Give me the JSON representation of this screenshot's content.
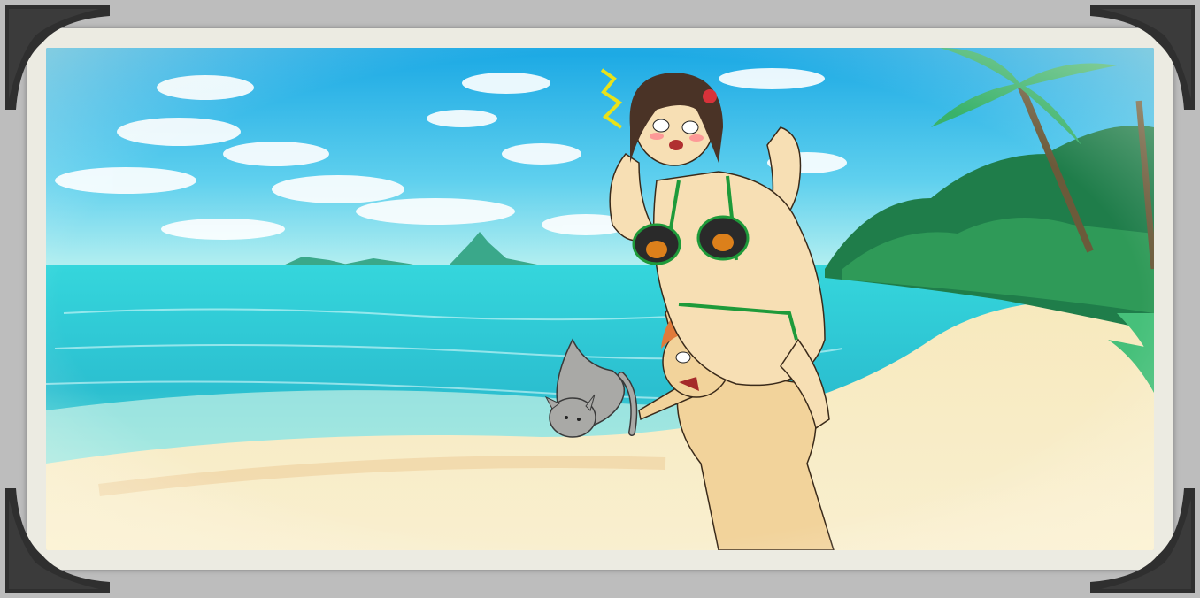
{
  "frame": {
    "background_color": "#bdbdbd",
    "mat_color": "#ecebe2",
    "corner_color": "#2f2f2f"
  },
  "photo": {
    "scene": "beach",
    "palette": {
      "sky_top": "#2fb6e8",
      "sky_bottom": "#9fe6f0",
      "sea": "#2ed0d4",
      "sand": "#f6e6b6",
      "foliage": "#1f7d4a"
    }
  }
}
